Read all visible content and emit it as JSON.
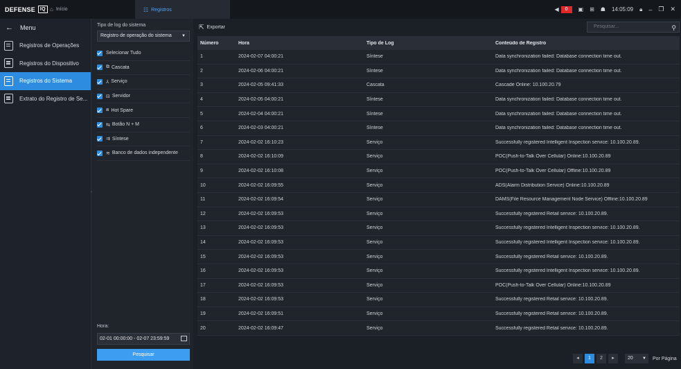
{
  "app": {
    "logo_text": "DEFENSE",
    "logo_badge": "IQ",
    "tabs": [
      {
        "label": "Início",
        "icon": "home-icon"
      },
      {
        "label": "Registros",
        "icon": "grid-icon"
      }
    ],
    "alarm_count": "0",
    "clock": "14:05:09"
  },
  "sidebar": {
    "menu_label": "Menu",
    "items": [
      {
        "label": "Registros de Operações"
      },
      {
        "label": "Registros do Dispositivo"
      },
      {
        "label": "Registros do Sistema"
      },
      {
        "label": "Extrato do Registro de Se..."
      }
    ]
  },
  "filter": {
    "type_label": "Tipo de log do sistema",
    "type_value": "Registro de operação do sistema",
    "checkboxes": [
      {
        "label": "Selecionar Tudo",
        "icon": ""
      },
      {
        "label": "Cascata",
        "icon": "cascade-icon"
      },
      {
        "label": "Serviço",
        "icon": "service-icon"
      },
      {
        "label": "Servidor",
        "icon": "server-icon"
      },
      {
        "label": "Hot Spare",
        "icon": "hotspare-icon"
      },
      {
        "label": "Botão N + M",
        "icon": "nm-icon"
      },
      {
        "label": "Síntese",
        "icon": "synthesis-icon"
      },
      {
        "label": "Banco de dados independente",
        "icon": "database-icon"
      }
    ],
    "time_label": "Hora:",
    "time_value": "02-01 00:00:00 - 02-07 23:59:59",
    "search_button": "Pesquisar"
  },
  "main": {
    "export_label": "Exportar",
    "search_placeholder": "Pesquisar...",
    "columns": [
      "Número",
      "Hora",
      "Tipo de Log",
      "Conteúdo de Registro"
    ],
    "rows": [
      [
        "1",
        "2024-02-07 04:00:21",
        "Síntese",
        "Data synchronization failed: Database connection time out."
      ],
      [
        "2",
        "2024-02-06 04:00:21",
        "Síntese",
        "Data synchronization failed: Database connection time out."
      ],
      [
        "3",
        "2024-02-05 09:41:33",
        "Cascata",
        "Cascade Online: 10.100.20.79"
      ],
      [
        "4",
        "2024-02-05 04:00:21",
        "Síntese",
        "Data synchronization failed: Database connection time out."
      ],
      [
        "5",
        "2024-02-04 04:00:21",
        "Síntese",
        "Data synchronization failed: Database connection time out."
      ],
      [
        "6",
        "2024-02-03 04:00:21",
        "Síntese",
        "Data synchronization failed: Database connection time out."
      ],
      [
        "7",
        "2024-02-02 16:10:23",
        "Serviço",
        "Successfully registered Intelligent Inspection service: 10.100.20.89."
      ],
      [
        "8",
        "2024-02-02 16:10:09",
        "Serviço",
        "POC(Push-to-Talk Over Cellular) Online:10.100.20.89"
      ],
      [
        "9",
        "2024-02-02 16:10:08",
        "Serviço",
        "POC(Push-to-Talk Over Cellular) Offline:10.100.20.89"
      ],
      [
        "10",
        "2024-02-02 16:09:55",
        "Serviço",
        "ADS(Alarm Distribution Service) Online:10.100.20.89"
      ],
      [
        "11",
        "2024-02-02 16:09:54",
        "Serviço",
        "DAMS(File Resource Management Node Service) Offline:10.100.20.89"
      ],
      [
        "12",
        "2024-02-02 16:09:53",
        "Serviço",
        "Successfully registered Retail service: 10.100.20.89."
      ],
      [
        "13",
        "2024-02-02 16:09:53",
        "Serviço",
        "Successfully registered Intelligent Inspection service: 10.100.20.89."
      ],
      [
        "14",
        "2024-02-02 16:09:53",
        "Serviço",
        "Successfully registered Intelligent Inspection service: 10.100.20.89."
      ],
      [
        "15",
        "2024-02-02 16:09:53",
        "Serviço",
        "Successfully registered Retail service: 10.100.20.89."
      ],
      [
        "16",
        "2024-02-02 16:09:53",
        "Serviço",
        "Successfully registered Intelligent Inspection service: 10.100.20.89."
      ],
      [
        "17",
        "2024-02-02 16:09:53",
        "Serviço",
        "POC(Push-to-Talk Over Cellular) Online:10.100.20.89"
      ],
      [
        "18",
        "2024-02-02 16:09:53",
        "Serviço",
        "Successfully registered Retail service: 10.100.20.89."
      ],
      [
        "19",
        "2024-02-02 16:09:51",
        "Serviço",
        "Successfully registered Retail service: 10.100.20.89."
      ],
      [
        "20",
        "2024-02-02 16:09:47",
        "Serviço",
        "Successfully registered Retail service: 10.100.20.89."
      ]
    ],
    "pagination": {
      "pages": [
        "1",
        "2"
      ],
      "current": "1",
      "per_page": "20",
      "per_page_label": "Por Página"
    }
  },
  "colors": {
    "accent": "#2e8ce0",
    "alarm": "#e0282d",
    "background": "#1b1f26"
  }
}
